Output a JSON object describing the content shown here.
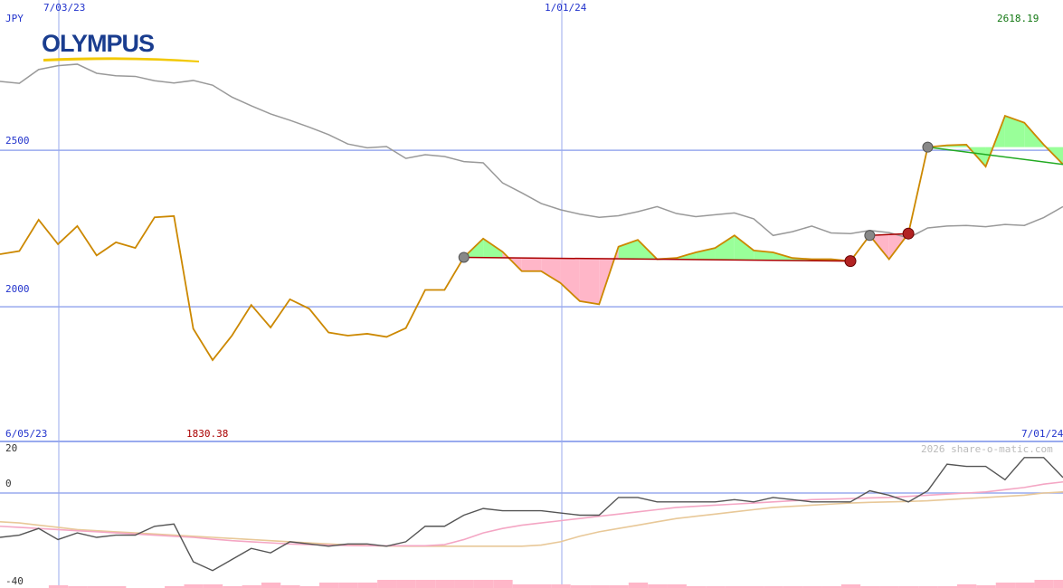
{
  "currency_label": "JPY",
  "logo_text": "OLYMPUS",
  "watermark": "2026 share-o-matic.com",
  "top_dates": [
    "7/03/23",
    "1/01/24"
  ],
  "bottom_dates": [
    "6/05/23",
    "7/01/24"
  ],
  "last_price_label": "2618.19",
  "low_price_label": "1830.38",
  "colors": {
    "price": "#cc8800",
    "ma": "#999999",
    "gain": "#99ff99",
    "loss": "#ffb6c8",
    "trend_down": "#aa0000",
    "trend_up": "#22aa22",
    "grid": "#99aaee",
    "label": "#2233cc",
    "logo": "#1a3d8f",
    "logo_swoosh": "#f2c800"
  },
  "chart_data": [
    {
      "type": "line",
      "panel": "price",
      "ylabel": "JPY",
      "y_ticks": [
        "2500",
        "2000"
      ],
      "ylim": [
        1570,
        2980
      ],
      "x_date_ticks": [
        "7/03/23",
        "1/01/24"
      ],
      "series": [
        {
          "role": "price",
          "x": [
            0,
            1,
            2,
            3,
            4,
            5,
            6,
            7,
            8,
            9,
            10,
            11,
            12,
            13,
            14,
            15,
            16,
            17,
            18,
            19,
            20,
            21,
            22,
            23,
            24,
            25,
            26,
            27,
            28,
            29,
            30,
            31,
            32,
            33,
            34,
            35,
            36,
            37,
            38,
            39,
            40,
            41,
            42,
            43,
            44,
            45,
            46,
            47,
            48,
            49,
            50,
            51,
            52,
            53,
            54,
            55
          ],
          "values": [
            2168,
            2178,
            2278,
            2200,
            2258,
            2164,
            2206,
            2188,
            2286,
            2290,
            1930,
            1830,
            1908,
            2006,
            1934,
            2024,
            1994,
            1918,
            1908,
            1914,
            1904,
            1932,
            2054,
            2054,
            2158,
            2218,
            2176,
            2114,
            2114,
            2076,
            2018,
            2008,
            2192,
            2214,
            2152,
            2156,
            2174,
            2188,
            2228,
            2180,
            2174,
            2156,
            2152,
            2152,
            2146,
            2228,
            2152,
            2234,
            2510,
            2516,
            2518,
            2448,
            2610,
            2588,
            2518,
            2455
          ],
          "markers": [
            {
              "index": 24,
              "kind": "gray"
            },
            {
              "index": 44,
              "kind": "red"
            },
            {
              "index": 45,
              "kind": "gray"
            },
            {
              "index": 47,
              "kind": "red"
            },
            {
              "index": 48,
              "kind": "gray"
            }
          ],
          "trends": [
            {
              "from": 24,
              "to": 44,
              "kind": "down"
            },
            {
              "from": 45,
              "to": 47,
              "kind": "down"
            },
            {
              "from": 48,
              "to": 55,
              "kind": "up"
            }
          ]
        },
        {
          "role": "moving-average",
          "x": [
            0,
            1,
            2,
            3,
            4,
            5,
            6,
            7,
            8,
            9,
            10,
            11,
            12,
            13,
            14,
            15,
            16,
            17,
            18,
            19,
            20,
            21,
            22,
            23,
            24,
            25,
            26,
            27,
            28,
            29,
            30,
            31,
            32,
            33,
            34,
            35,
            36,
            37,
            38,
            39,
            40,
            41,
            42,
            43,
            44,
            45,
            46,
            47,
            48,
            49,
            50,
            51,
            52,
            53,
            54,
            55
          ],
          "values": [
            2720,
            2714,
            2758,
            2770,
            2775,
            2746,
            2738,
            2736,
            2722,
            2715,
            2723,
            2708,
            2670,
            2642,
            2616,
            2596,
            2574,
            2550,
            2520,
            2508,
            2512,
            2474,
            2486,
            2480,
            2464,
            2460,
            2396,
            2364,
            2330,
            2310,
            2296,
            2286,
            2291,
            2304,
            2320,
            2298,
            2288,
            2294,
            2300,
            2281,
            2228,
            2240,
            2258,
            2236,
            2234,
            2244,
            2237,
            2220,
            2252,
            2258,
            2260,
            2256,
            2263,
            2260,
            2285,
            2320
          ]
        }
      ]
    },
    {
      "type": "line",
      "panel": "momentum",
      "y_ticks": [
        "20",
        "0",
        "-40"
      ],
      "ylim": [
        -40,
        20
      ],
      "x_date_ticks": [
        "6/05/23",
        "7/01/24"
      ],
      "series": [
        {
          "role": "momentum",
          "values": [
            -20,
            -19,
            -16,
            -21,
            -18,
            -20,
            -19,
            -19,
            -15,
            -14,
            -31,
            -35,
            -30,
            -25,
            -27,
            -22,
            -23,
            -24,
            -23,
            -23,
            -24,
            -22,
            -15,
            -15,
            -10,
            -7,
            -8,
            -8,
            -8,
            -9,
            -10,
            -10,
            -2,
            -2,
            -4,
            -4,
            -4,
            -4,
            -3,
            -4,
            -2,
            -3,
            -4,
            -4,
            -4,
            1,
            -1,
            -4,
            1,
            13,
            12,
            12,
            6,
            16,
            16,
            7
          ]
        },
        {
          "role": "signal-pink",
          "values": [
            -15,
            -15.5,
            -16,
            -16.5,
            -17,
            -17.5,
            -18,
            -18.5,
            -19,
            -19.5,
            -20,
            -20.8,
            -21.5,
            -22,
            -22.5,
            -23,
            -23.3,
            -23.5,
            -23.7,
            -23.8,
            -23.8,
            -23.8,
            -23.8,
            -23.3,
            -21,
            -18,
            -16,
            -14.5,
            -13.5,
            -12.5,
            -11.5,
            -10.5,
            -9.5,
            -8.5,
            -7.5,
            -6.5,
            -6,
            -5.5,
            -5,
            -4.5,
            -4,
            -3.5,
            -3,
            -2.8,
            -2.5,
            -2.2,
            -2,
            -1.5,
            -1,
            -0.5,
            0,
            0.5,
            1.5,
            2.5,
            4,
            5
          ]
        },
        {
          "role": "signal-tan",
          "values": [
            -13,
            -13.5,
            -14.5,
            -15.5,
            -16.5,
            -17,
            -17.5,
            -18,
            -18.5,
            -19,
            -19.5,
            -20,
            -20.5,
            -21,
            -21.5,
            -22,
            -22.5,
            -23,
            -23.4,
            -23.7,
            -23.9,
            -24,
            -24,
            -24,
            -24,
            -24,
            -24,
            -24,
            -23.5,
            -22,
            -19.5,
            -17.5,
            -16,
            -14.5,
            -13,
            -11.5,
            -10.5,
            -9.5,
            -8.5,
            -7.5,
            -6.5,
            -6,
            -5.5,
            -5,
            -4.5,
            -4.2,
            -4,
            -3.8,
            -3.5,
            -3,
            -2.5,
            -2,
            -1.5,
            -1,
            0,
            0.5
          ]
        },
        {
          "role": "volume-bars",
          "values": [
            0,
            0,
            0,
            0.3,
            0.2,
            0.2,
            0.2,
            0,
            0,
            0.2,
            0.4,
            0.4,
            0.2,
            0.3,
            0.6,
            0.3,
            0.2,
            0.6,
            0.6,
            0.6,
            0.9,
            0.9,
            0.9,
            0.9,
            0.9,
            0.9,
            0.9,
            0.4,
            0.4,
            0.4,
            0.3,
            0.3,
            0.3,
            0.6,
            0.4,
            0.4,
            0.2,
            0.2,
            0.2,
            0.2,
            0.2,
            0.2,
            0.2,
            0.2,
            0.4,
            0.2,
            0.2,
            0.2,
            0.2,
            0.2,
            0.4,
            0.3,
            0.6,
            0.6,
            0.9,
            0.9
          ]
        }
      ]
    }
  ]
}
